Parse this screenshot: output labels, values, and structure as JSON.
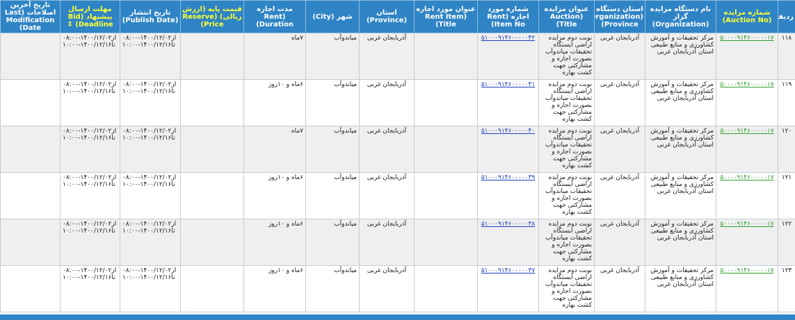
{
  "headers": [
    {
      "key": "row_no",
      "label": "ردیف",
      "highlight": false
    },
    {
      "key": "auction_no",
      "label": "شماره مزایده (Auction No)",
      "highlight": true
    },
    {
      "key": "organization",
      "label": "نام دستگاه مزایده گزار (Organization)",
      "highlight": false
    },
    {
      "key": "org_province",
      "label": "استان دستگاه (Organization Province)",
      "highlight": false
    },
    {
      "key": "auction_title",
      "label": "عنوان مزایده (Auction Title)",
      "highlight": false
    },
    {
      "key": "rent_item_no",
      "label": "شماره مورد اجاره (Rent Item No)",
      "highlight": false
    },
    {
      "key": "rent_item_title",
      "label": "عنوان مورد اجاره (Rent Item Title)",
      "highlight": false
    },
    {
      "key": "province",
      "label": "استان (Province)",
      "highlight": false
    },
    {
      "key": "city",
      "label": "شهر (City)",
      "highlight": false
    },
    {
      "key": "rent_duration",
      "label": "مدت اجاره (Rent Duration)",
      "highlight": false
    },
    {
      "key": "reserve_price",
      "label": "قیمت پایه (ارزش ریالی) (Reserve Price)",
      "highlight": true
    },
    {
      "key": "publish_date",
      "label": "تاریخ انتشار (Publish Date)",
      "highlight": false
    },
    {
      "key": "bid_deadline",
      "label": "مهلت ارسال پیشنهاد (Bid Deadline) ⇕",
      "highlight": true
    },
    {
      "key": "last_mod",
      "label": "تاریخ آخرین اصلاحات (Last Modification Date)",
      "highlight": false
    }
  ],
  "rows": [
    {
      "row_no": "۱۱۸",
      "auction_no": "۵۰۰۰۰۹۱۴۶۰۰۰۰۰۱۷",
      "organization": "مرکز تحقیقات و آموزش کشاورزی و منابع طبیعی استان آذربایجان غربی",
      "org_province": "آذربایجان غربی",
      "auction_title": "نوبت دوم مزایده اراضی ایستگاه تحقیقات میاندوآب بصورت اجاره و مشارکتی جهت کشت بهاره",
      "rent_item_no": "۵۱۰۰۰۹۱۴۶۰۰۰۰۰۴۲",
      "rent_item_title": "",
      "province": "آذربایجان غربی",
      "city": "میاندوآب",
      "rent_duration": "۷ماه",
      "reserve_price": "",
      "publish_date_1": "از۱۴۰۰/۱۲/۰۲-۰۸:۰۰",
      "publish_date_2": "تا۱۴۰۰/۱۲/۱۶-۱۰:۰۰",
      "deadline_1": "از۱۴۰۰/۱۲/۰۲-۰۸:۰۰",
      "deadline_2": "تا۱۴۰۰/۱۲/۱۶-۱۰:۰۰",
      "last_mod": ""
    },
    {
      "row_no": "۱۱۹",
      "auction_no": "۵۰۰۰۰۹۱۴۶۰۰۰۰۰۱۷",
      "organization": "مرکز تحقیقات و آموزش کشاورزی و منابع طبیعی استان آذربایجان غربی",
      "org_province": "آذربایجان غربی",
      "auction_title": "نوبت دوم مزایده اراضی ایستگاه تحقیقات میاندوآب بصورت اجاره و مشارکتی جهت کشت بهاره",
      "rent_item_no": "۵۱۰۰۰۹۱۴۶۰۰۰۰۰۴۱",
      "rent_item_title": "",
      "province": "آذربایجان غربی",
      "city": "میاندوآب",
      "rent_duration": "۶ماه و ۱۰روز",
      "reserve_price": "",
      "publish_date_1": "از۱۴۰۰/۱۲/۰۲-۰۸:۰۰",
      "publish_date_2": "تا۱۴۰۰/۱۲/۱۶-۱۰:۰۰",
      "deadline_1": "از۱۴۰۰/۱۲/۰۲-۰۸:۰۰",
      "deadline_2": "تا۱۴۰۰/۱۲/۱۶-۱۰:۰۰",
      "last_mod": ""
    },
    {
      "row_no": "۱۲۰",
      "auction_no": "۵۰۰۰۰۹۱۴۶۰۰۰۰۰۱۷",
      "organization": "مرکز تحقیقات و آموزش کشاورزی و منابع طبیعی استان آذربایجان غربی",
      "org_province": "آذربایجان غربی",
      "auction_title": "نوبت دوم مزایده اراضی ایستگاه تحقیقات میاندوآب بصورت اجاره و مشارکتی جهت کشت بهاره",
      "rent_item_no": "۵۱۰۰۰۹۱۴۶۰۰۰۰۰۴۰",
      "rent_item_title": "",
      "province": "آذربایجان غربی",
      "city": "میاندوآب",
      "rent_duration": "۷ماه",
      "reserve_price": "",
      "publish_date_1": "از۱۴۰۰/۱۲/۰۲-۰۸:۰۰",
      "publish_date_2": "تا۱۴۰۰/۱۲/۱۶-۱۰:۰۰",
      "deadline_1": "از۱۴۰۰/۱۲/۰۲-۰۸:۰۰",
      "deadline_2": "تا۱۴۰۰/۱۲/۱۶-۱۰:۰۰",
      "last_mod": ""
    },
    {
      "row_no": "۱۲۱",
      "auction_no": "۵۰۰۰۰۹۱۴۶۰۰۰۰۰۱۷",
      "organization": "مرکز تحقیقات و آموزش کشاورزی و منابع طبیعی استان آذربایجان غربی",
      "org_province": "آذربایجان غربی",
      "auction_title": "نوبت دوم مزایده اراضی ایستگاه تحقیقات میاندوآب بصورت اجاره و مشارکتی جهت کشت بهاره",
      "rent_item_no": "۵۱۰۰۰۹۱۴۶۰۰۰۰۰۳۹",
      "rent_item_title": "",
      "province": "آذربایجان غربی",
      "city": "میاندوآب",
      "rent_duration": "۶ماه و ۱۰روز",
      "reserve_price": "",
      "publish_date_1": "از۱۴۰۰/۱۲/۰۲-۰۸:۰۰",
      "publish_date_2": "تا۱۴۰۰/۱۲/۱۶-۱۰:۰۰",
      "deadline_1": "از۱۴۰۰/۱۲/۰۲-۰۸:۰۰",
      "deadline_2": "تا۱۴۰۰/۱۲/۱۶-۱۰:۰۰",
      "last_mod": ""
    },
    {
      "row_no": "۱۲۲",
      "auction_no": "۵۰۰۰۰۹۱۴۶۰۰۰۰۰۱۷",
      "organization": "مرکز تحقیقات و آموزش کشاورزی و منابع طبیعی استان آذربایجان غربی",
      "org_province": "آذربایجان غربی",
      "auction_title": "نوبت دوم مزایده اراضی ایستگاه تحقیقات میاندوآب بصورت اجاره و مشارکتی جهت کشت بهاره",
      "rent_item_no": "۵۱۰۰۰۹۱۴۶۰۰۰۰۰۳۸",
      "rent_item_title": "",
      "province": "آذربایجان غربی",
      "city": "میاندوآب",
      "rent_duration": "۶ماه و ۱۰روز",
      "reserve_price": "",
      "publish_date_1": "از۱۴۰۰/۱۲/۰۲-۰۸:۰۰",
      "publish_date_2": "تا۱۴۰۰/۱۲/۱۶-۱۰:۰۰",
      "deadline_1": "از۱۴۰۰/۱۲/۰۲-۰۸:۰۰",
      "deadline_2": "تا۱۴۰۰/۱۲/۱۶-۱۰:۰۰",
      "last_mod": ""
    },
    {
      "row_no": "۱۲۳",
      "auction_no": "۵۰۰۰۰۹۱۴۶۰۰۰۰۰۱۷",
      "organization": "مرکز تحقیقات و آموزش کشاورزی و منابع طبیعی استان آذربایجان غربی",
      "org_province": "آذربایجان غربی",
      "auction_title": "نوبت دوم مزایده اراضی ایستگاه تحقیقات میاندوآب بصورت اجاره و مشارکتی جهت کشت بهاره",
      "rent_item_no": "۵۱۰۰۰۹۱۴۶۰۰۰۰۰۳۷",
      "rent_item_title": "",
      "province": "آذربایجان غربی",
      "city": "میاندوآب",
      "rent_duration": "۶ماه و ۱۰روز",
      "reserve_price": "",
      "publish_date_1": "از۱۴۰۰/۱۲/۰۲-۰۸:۰۰",
      "publish_date_2": "تا۱۴۰۰/۱۲/۱۶-۱۰:۰۰",
      "deadline_1": "از۱۴۰۰/۱۲/۰۲-۰۸:۰۰",
      "deadline_2": "تا۱۴۰۰/۱۲/۱۶-۱۰:۰۰",
      "last_mod": ""
    }
  ],
  "colors": {
    "header_bg": "#2f84c5",
    "header_text": "#ffffff",
    "header_highlight": "#ffff33",
    "row_odd": "#efefef",
    "row_even": "#ffffff",
    "auction_link": "#2e9e2e",
    "rent_item_link": "#1a3fbf"
  }
}
